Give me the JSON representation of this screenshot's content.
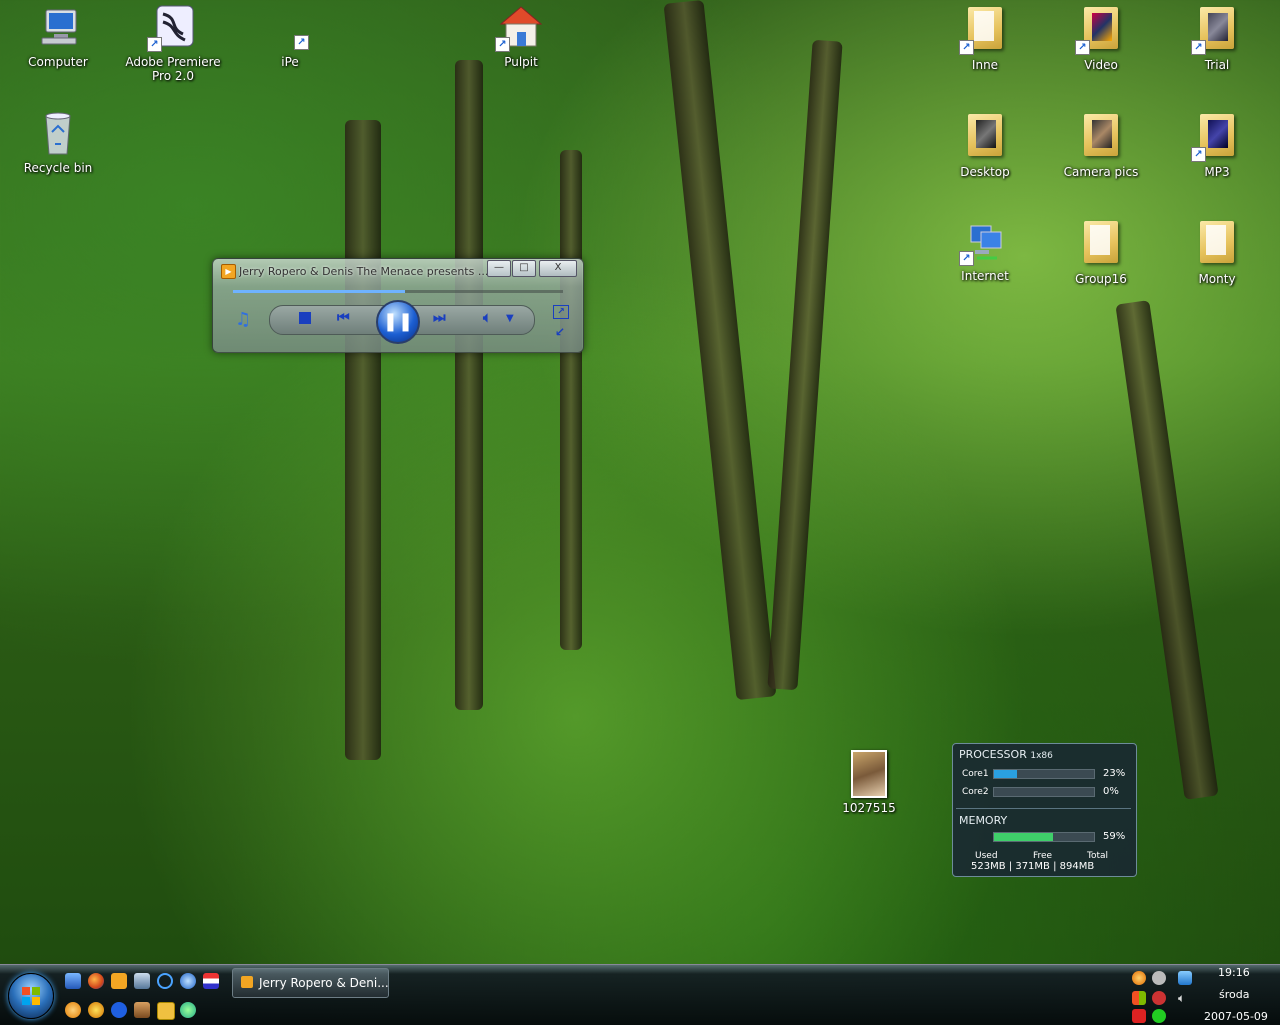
{
  "desktop": {
    "icons_left": [
      {
        "label": "Computer"
      },
      {
        "label": "Adobe Premiere Pro 2.0"
      },
      {
        "label": "iPe"
      },
      {
        "label": "Pulpit"
      },
      {
        "label": "Recycle bin"
      }
    ],
    "icons_right": [
      {
        "label": "Inne"
      },
      {
        "label": "Video"
      },
      {
        "label": "Trial"
      },
      {
        "label": "Desktop"
      },
      {
        "label": "Camera pics"
      },
      {
        "label": "MP3"
      },
      {
        "label": "Internet"
      },
      {
        "label": "Group16"
      },
      {
        "label": "Monty"
      }
    ],
    "photo_icon": {
      "label": "1027515"
    }
  },
  "media_player": {
    "title": "Jerry Ropero & Denis The Menace presents ...",
    "progress": 0.52,
    "caption_buttons": {
      "minimize": "—",
      "maximize": "□",
      "close": "X"
    }
  },
  "cpu_meter": {
    "processor_label": "PROCESSOR",
    "processor_arch": "1x86",
    "cores": [
      {
        "name": "Core1",
        "value": "23%",
        "level": 0.23
      },
      {
        "name": "Core2",
        "value": "0%",
        "level": 0.0
      }
    ],
    "memory_label": "MEMORY",
    "memory_value": "59%",
    "memory_level": 0.59,
    "used_label": "Used",
    "free_label": "Free",
    "total_label": "Total",
    "used_value": "523MB",
    "free_value": "371MB",
    "total_value": "894MB",
    "separator": "|"
  },
  "taskbar": {
    "task_button_label": "Jerry Ropero & Deni...",
    "clock_time": "19:16",
    "clock_day": "środa",
    "clock_date": "2007-05-09"
  },
  "colors": {
    "cpu_bar": "#2aa0e0",
    "memory_bar": "#3fcf6a"
  }
}
